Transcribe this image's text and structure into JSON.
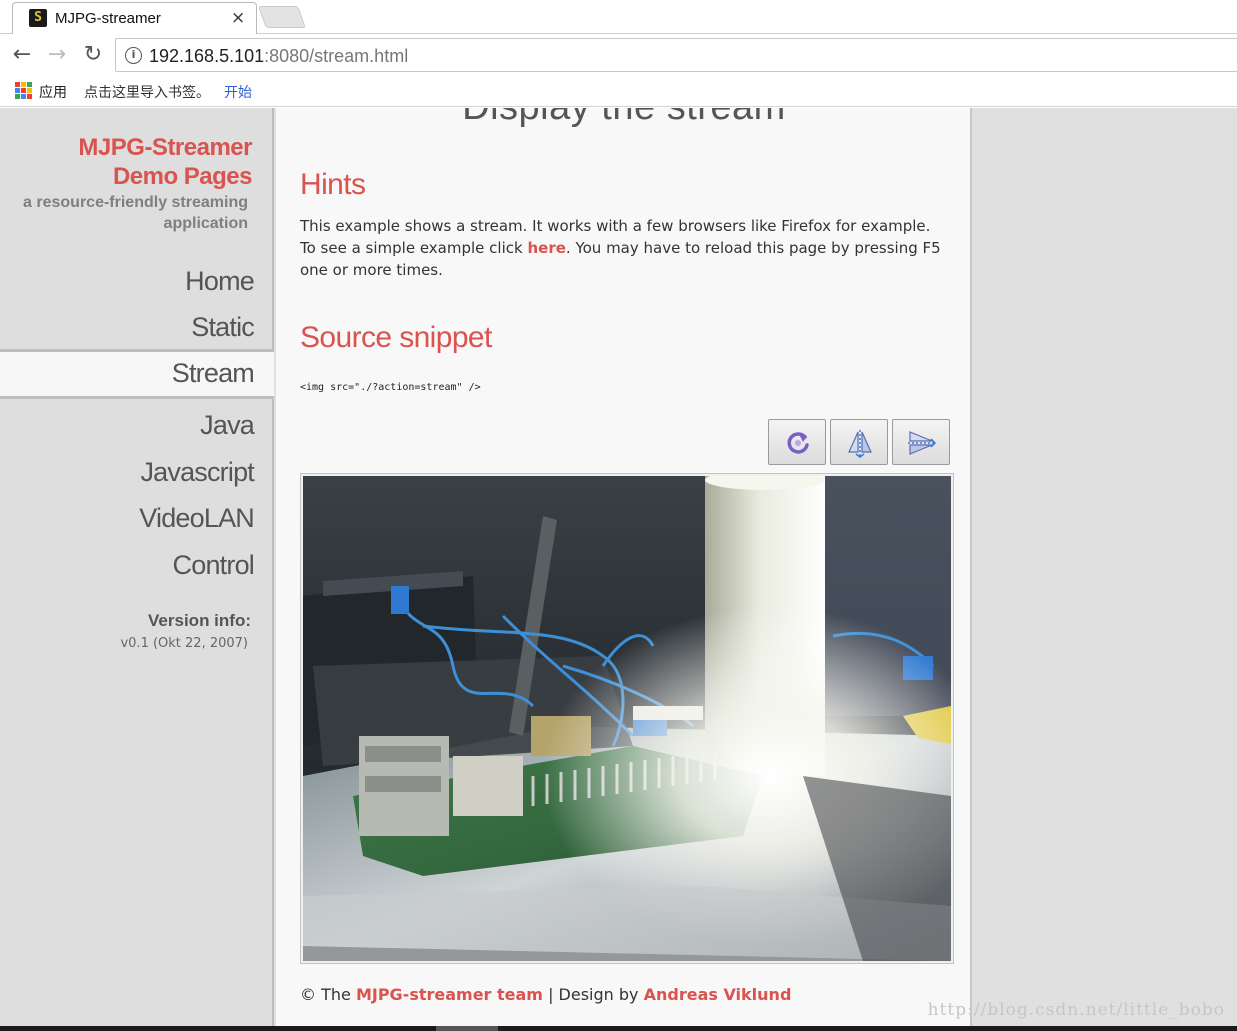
{
  "browser": {
    "tab_title": "MJPG-streamer",
    "tab_close": "×",
    "url_host": "192.168.5.101",
    "url_rest": ":8080/stream.html",
    "bookmarks": {
      "apps_label": "应用",
      "hint": "点击这里导入书签。",
      "start_link": "开始"
    }
  },
  "sidebar": {
    "logo_line1": "MJPG-Streamer",
    "logo_line2": "Demo Pages",
    "tagline": "a resource-friendly streaming application",
    "menu": [
      {
        "label": "Home",
        "active": false
      },
      {
        "label": "Static",
        "active": false
      },
      {
        "label": "Stream",
        "active": true
      },
      {
        "label": "Java",
        "active": false
      },
      {
        "label": "Javascript",
        "active": false
      },
      {
        "label": "VideoLAN",
        "active": false
      },
      {
        "label": "Control",
        "active": false
      }
    ],
    "version_label": "Version info:",
    "version_value": "v0.1 (Okt 22, 2007)"
  },
  "content": {
    "title": "Display the stream",
    "hints_heading": "Hints",
    "hints_text_1": "This example shows a stream. It works with a few browsers like Firefox for example. To see a simple example click ",
    "hints_link": "here",
    "hints_text_2": ". You may have to reload this page by pressing F5 one or more times.",
    "source_heading": "Source snippet",
    "snippet": "<img src=\"./?action=stream\" />",
    "buttons": [
      {
        "icon": "rotate-icon"
      },
      {
        "icon": "flip-horizontal-icon"
      },
      {
        "icon": "flip-vertical-icon"
      }
    ],
    "footer_prefix": "© The ",
    "footer_team_link": "MJPG-streamer team",
    "footer_middle": " | Design by ",
    "footer_designer_link": "Andreas Viklund"
  },
  "watermark": "http://blog.csdn.net/little_bobo",
  "colors": {
    "accent": "#d9534f",
    "sidebar_bg": "#dedede",
    "content_bg": "#f8f8f8",
    "link_blue": "#2a5fd8"
  }
}
